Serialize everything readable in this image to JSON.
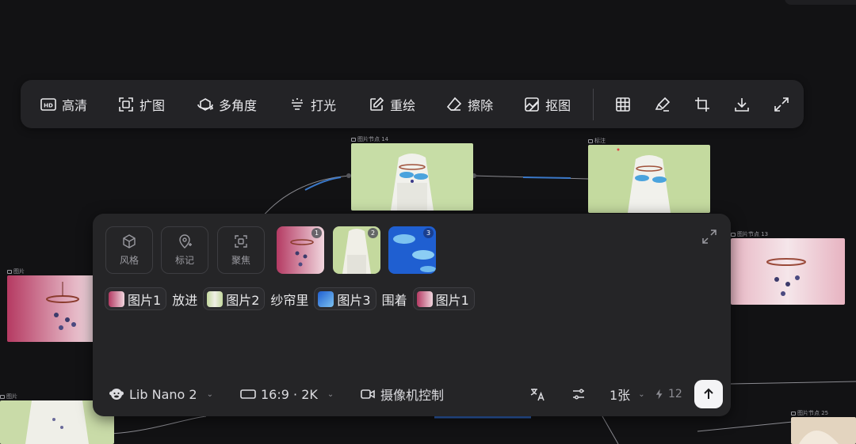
{
  "toolbar": {
    "items": [
      {
        "label": "高清",
        "icon": "hd-icon"
      },
      {
        "label": "扩图",
        "icon": "expand-frame-icon"
      },
      {
        "label": "多角度",
        "icon": "rotate-3d-icon"
      },
      {
        "label": "打光",
        "icon": "light-icon"
      },
      {
        "label": "重绘",
        "icon": "edit-icon"
      },
      {
        "label": "擦除",
        "icon": "eraser-icon"
      },
      {
        "label": "抠图",
        "icon": "cutout-icon"
      }
    ],
    "icons": [
      "grid-icon",
      "brush-icon",
      "crop-icon",
      "download-icon",
      "fullscreen-icon"
    ]
  },
  "nodes": {
    "center": {
      "label": "图片节点 14"
    },
    "right": {
      "label": "标注"
    },
    "left": {
      "label": "图片"
    },
    "right_mid": {
      "label": "图片节点 13"
    },
    "bottom_left": {
      "label": "图片"
    },
    "bottom_right": {
      "label": "图片节点 25"
    }
  },
  "panel": {
    "tools": [
      {
        "label": "风格",
        "icon": "cube-icon"
      },
      {
        "label": "标记",
        "icon": "pin-icon"
      },
      {
        "label": "聚焦",
        "icon": "focus-icon"
      }
    ],
    "refs": [
      {
        "badge": "1"
      },
      {
        "badge": "2"
      },
      {
        "badge": "3"
      }
    ],
    "prompt": {
      "chip1": "图片1",
      "text1": "放进",
      "chip2": "图片2",
      "text2": "纱帘里",
      "chip3": "图片3",
      "text3": "围着",
      "chip4": "图片1"
    },
    "bottom": {
      "model": "Lib Nano 2",
      "ratio": "16:9 · 2K",
      "camera": "摄像机控制",
      "count": "1张",
      "credits": "12"
    }
  },
  "colors": {
    "accent_edge": "#3a78c9",
    "panel_bg": "#252527",
    "canvas_bg": "#121214"
  }
}
